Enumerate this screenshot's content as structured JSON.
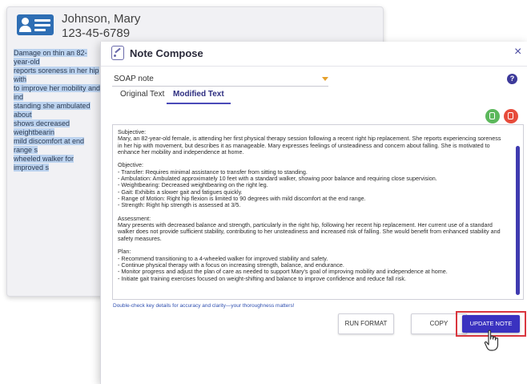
{
  "patient": {
    "name": "Johnson, Mary",
    "id": "123-45-6789"
  },
  "background_text": [
    "Damage on thin an 82-year-old",
    "reports soreness in her hip with",
    "to improve her mobility and ind",
    "standing she ambulated about",
    "shows decreased weightbearin",
    "mild discomfort at end range s",
    "wheeled walker for improved s"
  ],
  "modal": {
    "title": "Note Compose",
    "close_glyph": "×",
    "note_type": "SOAP note",
    "help_glyph": "?",
    "tabs": {
      "original": "Original Text",
      "modified": "Modified Text"
    },
    "note_text": "Subjective:\nMary, an 82-year-old female, is attending her first physical therapy session following a recent right hip replacement. She reports experiencing soreness in her hip with movement, but describes it as manageable. Mary expresses feelings of unsteadiness and concern about falling. She is motivated to enhance her mobility and independence at home.\n\nObjective:\n- Transfer: Requires minimal assistance to transfer from sitting to standing.\n- Ambulation: Ambulated approximately 10 feet with a standard walker, showing poor balance and requiring close supervision.\n- Weightbearing: Decreased weightbearing on the right leg.\n- Gait: Exhibits a slower gait and fatigues quickly.\n- Range of Motion: Right hip flexion is limited to 90 degrees with mild discomfort at the end range.\n- Strength: Right hip strength is assessed at 3/5.\n\nAssessment:\nMary presents with decreased balance and strength, particularly in the right hip, following her recent hip replacement. Her current use of a standard walker does not provide sufficient stability, contributing to her unsteadiness and increased risk of falling. She would benefit from enhanced stability and safety measures.\n\nPlan:\n- Recommend transitioning to a 4-wheeled walker for improved stability and safety.\n- Continue physical therapy with a focus on increasing strength, balance, and endurance.\n- Monitor progress and adjust the plan of care as needed to support Mary's goal of improving mobility and independence at home.\n- Initiate gait training exercises focused on weight-shifting and balance to improve confidence and reduce fall risk.",
    "hint": "Double-check key details for accuracy and clarity—your thoroughness matters!",
    "buttons": {
      "run_format": "RUN FORMAT",
      "copy": "COPY",
      "update_note": "UPDATE NOTE"
    }
  },
  "colors": {
    "accent": "#3a32c0",
    "highlight": "#bcd3ef",
    "thumb_up": "#5cb85c",
    "thumb_down": "#e74c3c",
    "focus_frame": "#d9363e"
  },
  "icons": {
    "patient": "id-card-icon",
    "compose": "note-compose-icon",
    "close": "close-icon",
    "help": "help-icon",
    "feedback_up": "thumbs-up-icon",
    "feedback_down": "thumbs-down-icon",
    "pointer": "hand-pointer-cursor-icon"
  }
}
